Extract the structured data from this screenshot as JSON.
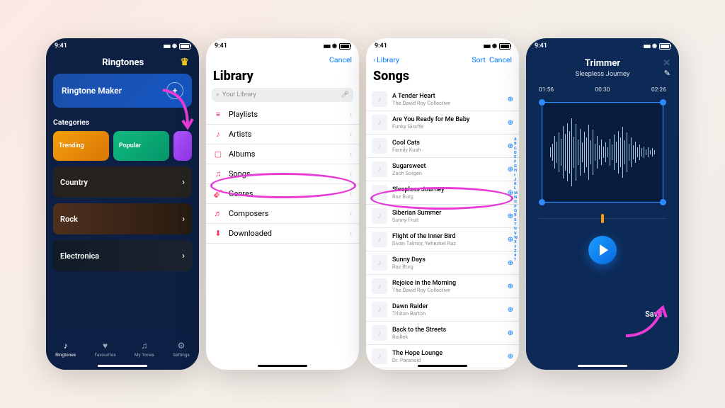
{
  "status_time": "9:41",
  "phone1": {
    "title": "Ringtones",
    "maker_label": "Ringtone Maker",
    "section": "Categories",
    "chips": [
      "Trending",
      "Popular"
    ],
    "genres": [
      "Country",
      "Rock",
      "Electronica"
    ],
    "tabs": [
      "Ringtones",
      "Favourites",
      "My Tones",
      "Settings"
    ]
  },
  "phone2": {
    "cancel": "Cancel",
    "title": "Library",
    "search_placeholder": "Your Library",
    "items": [
      "Playlists",
      "Artists",
      "Albums",
      "Songs",
      "Genres",
      "Composers",
      "Downloaded"
    ]
  },
  "phone3": {
    "back": "Library",
    "sort": "Sort",
    "cancel": "Cancel",
    "title": "Songs",
    "songs": [
      {
        "t": "A Tender Heart",
        "a": "The David Roy Collective"
      },
      {
        "t": "Are You Ready for Me Baby",
        "a": "Funky Giraffe"
      },
      {
        "t": "Cool Cats",
        "a": "Family Kush"
      },
      {
        "t": "Sugarsweet",
        "a": "Zach Sorgen"
      },
      {
        "t": "Sleepless Journey",
        "a": "Raz Burg"
      },
      {
        "t": "Siberian Summer",
        "a": "Sunny Fruit"
      },
      {
        "t": "Flight of the Inner Bird",
        "a": "Sivan Talmor, Yehezkel Raz"
      },
      {
        "t": "Sunny Days",
        "a": "Raz Burg"
      },
      {
        "t": "Rejoice in the Morning",
        "a": "The David Roy Collective"
      },
      {
        "t": "Dawn Raider",
        "a": "Tristan Barton"
      },
      {
        "t": "Back to the Streets",
        "a": "Roillek"
      },
      {
        "t": "The Hope Lounge",
        "a": "Dr. Paranoid"
      }
    ],
    "az": [
      "A",
      "B",
      "C",
      "D",
      "E",
      "F",
      "G",
      "H",
      "I",
      "J",
      "K",
      "L",
      "M",
      "N",
      "O",
      "P",
      "Q",
      "R",
      "S",
      "T",
      "U",
      "V",
      "W",
      "X",
      "Y",
      "Z",
      "#",
      "?"
    ]
  },
  "phone4": {
    "title": "Trimmer",
    "song": "Sleepless Journey",
    "t_left": "01:56",
    "t_mid": "00:30",
    "t_right": "02:26",
    "save": "Save"
  }
}
